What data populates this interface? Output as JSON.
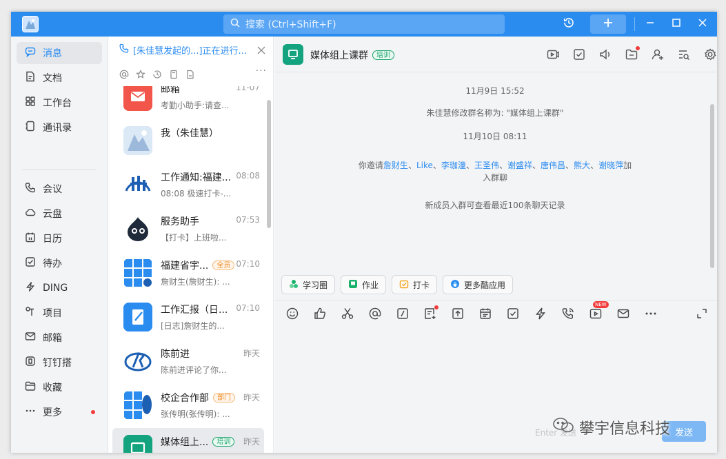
{
  "titlebar": {
    "search_placeholder": "搜索 (Ctrl+Shift+F)"
  },
  "nav": {
    "items": [
      {
        "label": "消息",
        "icon": "chat-bubble-icon"
      },
      {
        "label": "文档",
        "icon": "document-icon"
      },
      {
        "label": "工作台",
        "icon": "grid-icon"
      },
      {
        "label": "通讯录",
        "icon": "contacts-icon"
      },
      {
        "label": "会议",
        "icon": "phone-icon"
      },
      {
        "label": "云盘",
        "icon": "cloud-icon"
      },
      {
        "label": "日历",
        "icon": "calendar-icon"
      },
      {
        "label": "待办",
        "icon": "checkbox-icon"
      },
      {
        "label": "DING",
        "icon": "bolt-icon"
      },
      {
        "label": "项目",
        "icon": "project-icon"
      },
      {
        "label": "邮箱",
        "icon": "mail-icon"
      },
      {
        "label": "钉钉搭",
        "icon": "builder-icon"
      },
      {
        "label": "收藏",
        "icon": "folder-icon"
      },
      {
        "label": "更多",
        "icon": "more-icon"
      }
    ]
  },
  "list": {
    "live_banner": "[朱佳慧发起的...]正在进行...",
    "conversations": [
      {
        "name": "邮箱",
        "preview": "考勤小助手:请查...",
        "time": "11-07",
        "tag": ""
      },
      {
        "name": "我（朱佳慧）",
        "preview": "",
        "time": "",
        "tag": ""
      },
      {
        "name": "工作通知:福建...",
        "preview": "08:08 极速打卡-...",
        "time": "08:08",
        "tag": ""
      },
      {
        "name": "服务助手",
        "preview": "【打卡】上班啦...",
        "time": "07:53",
        "tag": ""
      },
      {
        "name": "福建省宇...",
        "preview": "詹财生(詹财生): ...",
        "time": "07:10",
        "tag": "全员"
      },
      {
        "name": "工作汇报（日...",
        "preview": "[日志]詹财生的...",
        "time": "07:10",
        "tag": ""
      },
      {
        "name": "陈前进",
        "preview": "陈前进评论了你...",
        "time": "昨天",
        "tag": ""
      },
      {
        "name": "校企合作部",
        "preview": "张传明(张传明): ...",
        "time": "昨天",
        "tag": "部门"
      },
      {
        "name": "媒体组上...",
        "preview": "",
        "time": "昨天",
        "tag": "培训"
      }
    ]
  },
  "chat": {
    "title": "媒体组上课群",
    "title_tag": "培训",
    "messages": {
      "time1": "11月9日 15:52",
      "rename": "朱佳慧修改群名称为: \"媒体组上课群\"",
      "time2": "11月10日 08:11",
      "invite_prefix": "你邀请",
      "invitees": [
        "詹财生",
        "Like",
        "李珈潼",
        "王圣伟",
        "谢盛祥",
        "唐伟昌",
        "熊大",
        "谢晓萍"
      ],
      "invite_suffix_a": "加",
      "invite_suffix_b": "入群聊",
      "history": "新成员入群可查看最近100条聊天记录"
    },
    "apps": [
      {
        "label": "学习圈"
      },
      {
        "label": "作业"
      },
      {
        "label": "打卡"
      },
      {
        "label": "更多酷应用"
      }
    ],
    "new_badge": "NEW",
    "hint": "Enter 发送",
    "send_label": "发送"
  },
  "watermark": "攀宇信息科技",
  "colors": {
    "accent": "#2b8cf0",
    "group_green": "#14a37f",
    "dot_red": "#f23c3c"
  }
}
